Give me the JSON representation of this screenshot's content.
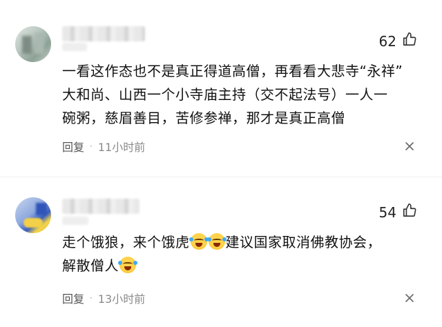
{
  "comments": [
    {
      "likes": "62",
      "text_lines": [
        "一看这作态也不是真正得道高僧，再看看大悲寺“永祥”",
        "大和尚、山西一个小寺庙主持（交不起法号）一人一",
        "碗粥，慈眉善目，苦修参禅，那才是真正高僧"
      ],
      "reply_label": "回复",
      "time": "11小时前"
    },
    {
      "likes": "54",
      "text_line1_a": "走个饿狼，来个饿虎",
      "text_line1_b": "建议国家取消佛教协会，",
      "text_line2": "解散僧人",
      "reply_label": "回复",
      "time": "13小时前"
    }
  ],
  "icons": {
    "like": "thumbs-up-icon",
    "more": "close-x-icon",
    "emoji": "laughing-crying-emoji"
  },
  "colors": {
    "text": "#111111",
    "meta": "#555555",
    "time": "#8a8a8a"
  }
}
